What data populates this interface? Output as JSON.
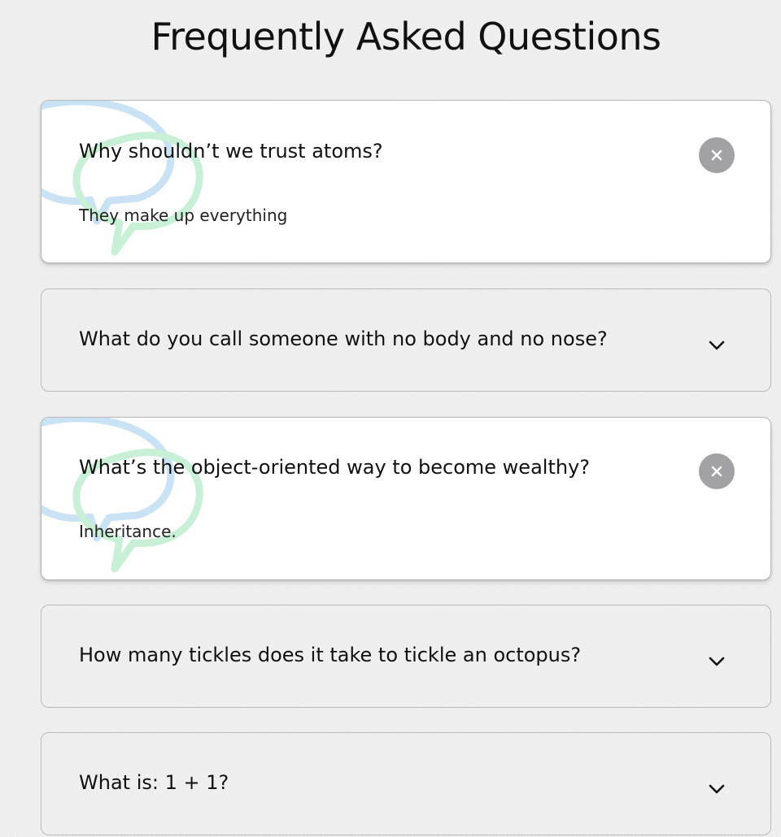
{
  "title": "Frequently Asked Questions",
  "faqs": [
    {
      "question": "Why shouldn’t we trust atoms?",
      "answer": "They make up everything",
      "expanded": true,
      "toggle_icon": "close-icon"
    },
    {
      "question": "What do you call someone with no body and no nose?",
      "answer": "",
      "expanded": false,
      "toggle_icon": "chevron-down-icon"
    },
    {
      "question": "What’s the object-oriented way to become wealthy?",
      "answer": "Inheritance.",
      "expanded": true,
      "toggle_icon": "close-icon"
    },
    {
      "question": "How many tickles does it take to tickle an octopus?",
      "answer": "",
      "expanded": false,
      "toggle_icon": "chevron-down-icon"
    },
    {
      "question": "What is: 1 + 1?",
      "answer": "",
      "expanded": false,
      "toggle_icon": "chevron-down-icon"
    }
  ],
  "colors": {
    "background": "#f0f0f0",
    "card_active": "#ffffff",
    "card_border": "#b9b9b9",
    "close_button": "#a2a2a5",
    "deco_blue": "#c9e2f4",
    "deco_green": "#c7f0d6"
  }
}
